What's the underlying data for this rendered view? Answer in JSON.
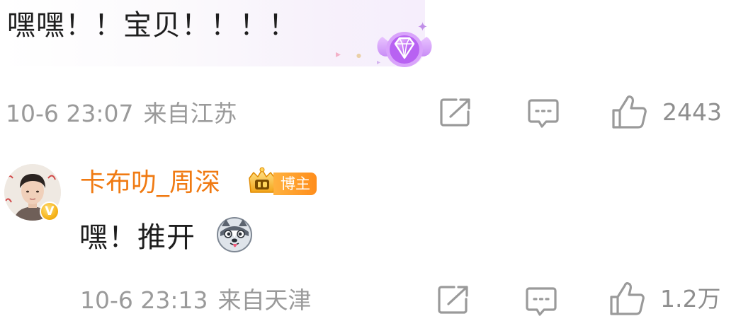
{
  "comments": [
    {
      "text": "嘿嘿！！宝贝！！！！",
      "time": "10-6 23:07",
      "location": "来自江苏",
      "likes": "2443",
      "badge_icon": "purple-diamond-wings-icon"
    },
    {
      "username": "卡布叻_周深",
      "author_badge": "博主",
      "text": "嘿！推开",
      "emoji_icon": "husky-dog-emoji-icon",
      "time": "10-6 23:13",
      "location": "来自天津",
      "likes": "1.2万",
      "verified_badge": "V"
    }
  ],
  "icons": {
    "share": "share-icon",
    "reply": "comment-reply-icon",
    "like": "thumbs-up-icon"
  },
  "colors": {
    "username": "#f07a12",
    "meta": "#9a9a9a",
    "author_tag": "#ff9a26",
    "text": "#1e1e1e"
  }
}
